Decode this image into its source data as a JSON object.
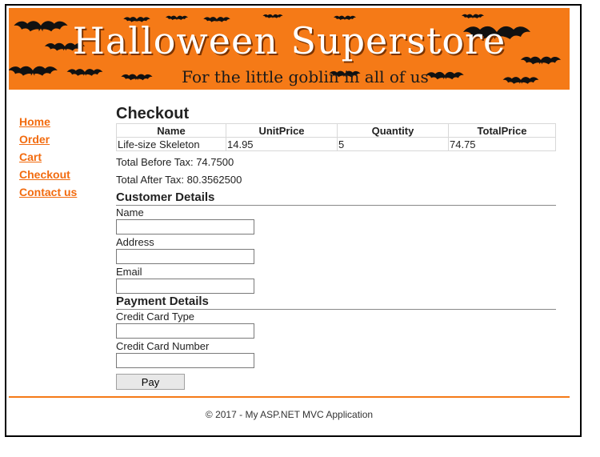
{
  "banner": {
    "title": "Halloween Superstore",
    "subtitle": "For the little goblin in all of us",
    "background_color": "#f57a17"
  },
  "nav": {
    "items": [
      {
        "label": "Home"
      },
      {
        "label": "Order"
      },
      {
        "label": "Cart"
      },
      {
        "label": "Checkout"
      },
      {
        "label": "Contact us"
      }
    ]
  },
  "checkout": {
    "title": "Checkout",
    "columns": [
      "Name",
      "UnitPrice",
      "Quantity",
      "TotalPrice"
    ],
    "rows": [
      [
        "Life-size Skeleton",
        "14.95",
        "5",
        "74.75"
      ]
    ],
    "total_before_tax": "Total Before Tax: 74.7500",
    "total_after_tax": "Total After Tax: 80.3562500"
  },
  "customer": {
    "title": "Customer Details",
    "name_label": "Name",
    "name_value": "",
    "address_label": "Address",
    "address_value": "",
    "email_label": "Email",
    "email_value": ""
  },
  "payment": {
    "title": "Payment Details",
    "card_type_label": "Credit Card Type",
    "card_type_value": "",
    "card_number_label": "Credit Card Number",
    "card_number_value": ""
  },
  "actions": {
    "pay_label": "Pay"
  },
  "footer": {
    "text": "© 2017 - My ASP.NET MVC Application",
    "accent_color": "#f57a17"
  }
}
